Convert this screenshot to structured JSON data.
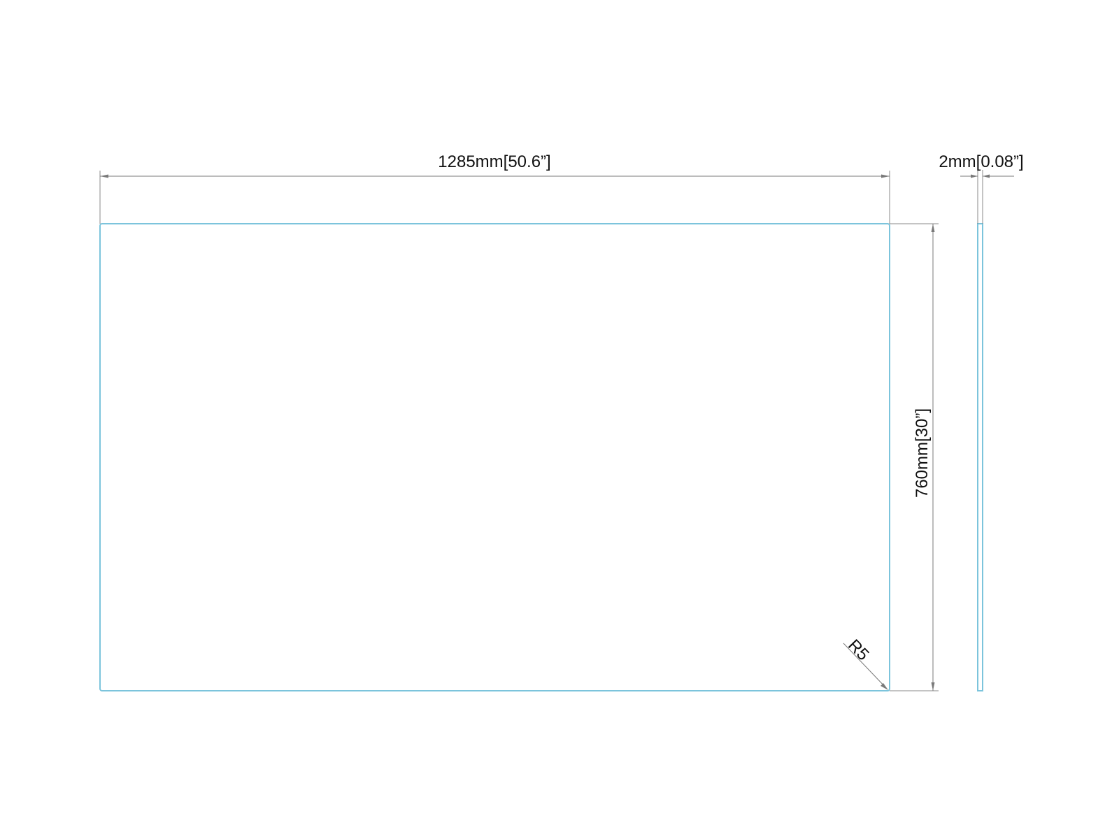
{
  "drawing": {
    "width_dimension": "1285mm[50.6”]",
    "height_dimension": "760mm[30”]",
    "thickness_dimension": "2mm[0.08”]",
    "corner_radius_label": "R5",
    "outline_color": "#7cc4dc",
    "dimension_line_color": "#7a7a7a",
    "text_color": "#111111"
  }
}
